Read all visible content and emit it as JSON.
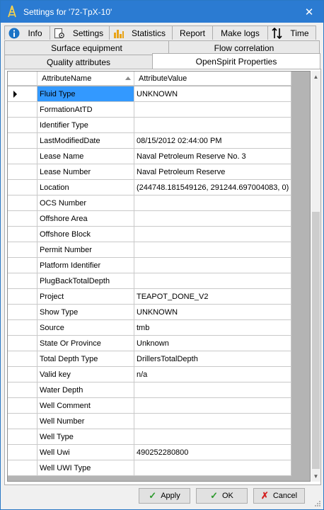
{
  "window": {
    "title": "Settings for '72-TpX-10'",
    "accent_color": "#2b7bd2"
  },
  "tabs_row1": [
    {
      "label": "Info",
      "icon": "info-icon"
    },
    {
      "label": "Settings",
      "icon": "settings-doc-icon"
    },
    {
      "label": "Statistics",
      "icon": "bar-chart-icon"
    },
    {
      "label": "Report",
      "icon": ""
    },
    {
      "label": "Make logs",
      "icon": ""
    },
    {
      "label": "Time",
      "icon": "time-arrows-icon"
    }
  ],
  "tabs_row2": [
    {
      "label": "Surface equipment"
    },
    {
      "label": "Flow correlation"
    }
  ],
  "tabs_row3": [
    {
      "label": "Quality attributes"
    },
    {
      "label": "OpenSpirit Properties",
      "active": true
    }
  ],
  "grid": {
    "headers": [
      "AttributeName",
      "AttributeValue"
    ],
    "rows": [
      {
        "name": "Fluid Type",
        "value": "UNKNOWN",
        "selected": true
      },
      {
        "name": "FormationAtTD",
        "value": ""
      },
      {
        "name": "Identifier Type",
        "value": ""
      },
      {
        "name": "LastModifiedDate",
        "value": "08/15/2012 02:44:00 PM"
      },
      {
        "name": "Lease Name",
        "value": "Naval Petroleum Reserve No. 3"
      },
      {
        "name": "Lease Number",
        "value": "Naval Petroleum Reserve"
      },
      {
        "name": "Location",
        "value": "(244748.181549126, 291244.697004083, 0)"
      },
      {
        "name": "OCS Number",
        "value": ""
      },
      {
        "name": "Offshore Area",
        "value": ""
      },
      {
        "name": "Offshore Block",
        "value": ""
      },
      {
        "name": "Permit Number",
        "value": ""
      },
      {
        "name": "Platform Identifier",
        "value": ""
      },
      {
        "name": "PlugBackTotalDepth",
        "value": ""
      },
      {
        "name": "Project",
        "value": "TEAPOT_DONE_V2"
      },
      {
        "name": "Show Type",
        "value": "UNKNOWN"
      },
      {
        "name": "Source",
        "value": "tmb"
      },
      {
        "name": "State Or Province",
        "value": "Unknown"
      },
      {
        "name": "Total Depth Type",
        "value": "DrillersTotalDepth"
      },
      {
        "name": "Valid key",
        "value": "n/a"
      },
      {
        "name": "Water Depth",
        "value": ""
      },
      {
        "name": "Well Comment",
        "value": ""
      },
      {
        "name": "Well Number",
        "value": ""
      },
      {
        "name": "Well Type",
        "value": ""
      },
      {
        "name": "Well Uwi",
        "value": "490252280800"
      },
      {
        "name": "Well UWI Type",
        "value": ""
      }
    ]
  },
  "buttons": {
    "apply": "Apply",
    "ok": "OK",
    "cancel": "Cancel"
  }
}
